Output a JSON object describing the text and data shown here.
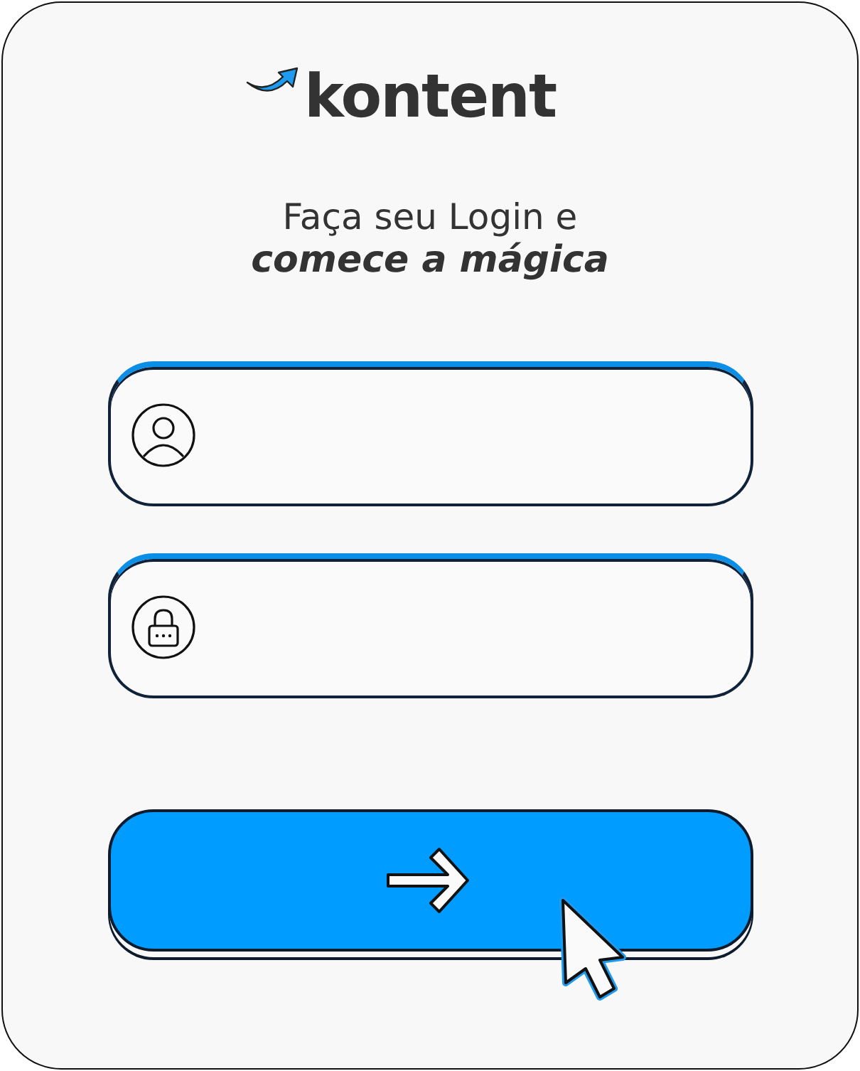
{
  "logo": {
    "text": "kontent"
  },
  "heading": {
    "line_1": "Faça seu Login e",
    "line_2": "comece a mágica"
  },
  "fields": [
    {
      "kind": "user"
    },
    {
      "kind": "password"
    }
  ]
}
